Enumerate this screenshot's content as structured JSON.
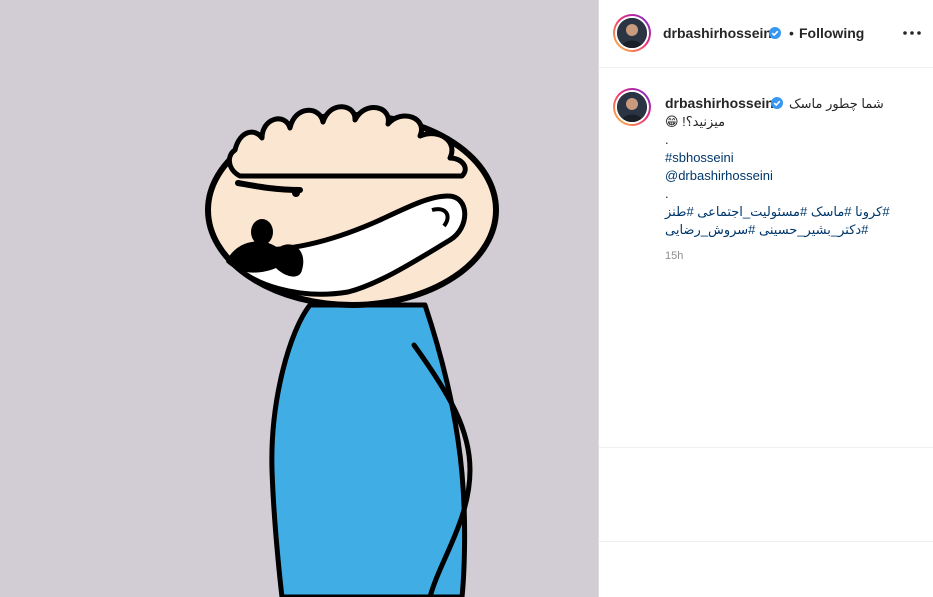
{
  "post": {
    "username": "drbashirhosseini",
    "follow_status": "Following",
    "separator": "•",
    "caption": {
      "line1": "شما چطور ماسک",
      "line2": "میزنید؟! 😁",
      "dot1": ".",
      "hashtag_user": "#sbhosseini",
      "mention": "@drbashirhosseini",
      "dot2": ".",
      "hashtags_line1": "#کرونا #ماسک #مسئولیت_اجتماعی #طنز",
      "hashtags_line2": "#دکتر_بشیر_حسینی #سروش_رضایی"
    },
    "timestamp": "15h"
  },
  "icons": {
    "verified": "verified-badge-icon",
    "more": "more-options-icon"
  },
  "colors": {
    "background_media": "#d2cdd4",
    "shirt": "#40aee4",
    "skin": "#fbe7d1",
    "mask": "#ffffff",
    "link": "#00376b",
    "verified": "#3897f0"
  }
}
